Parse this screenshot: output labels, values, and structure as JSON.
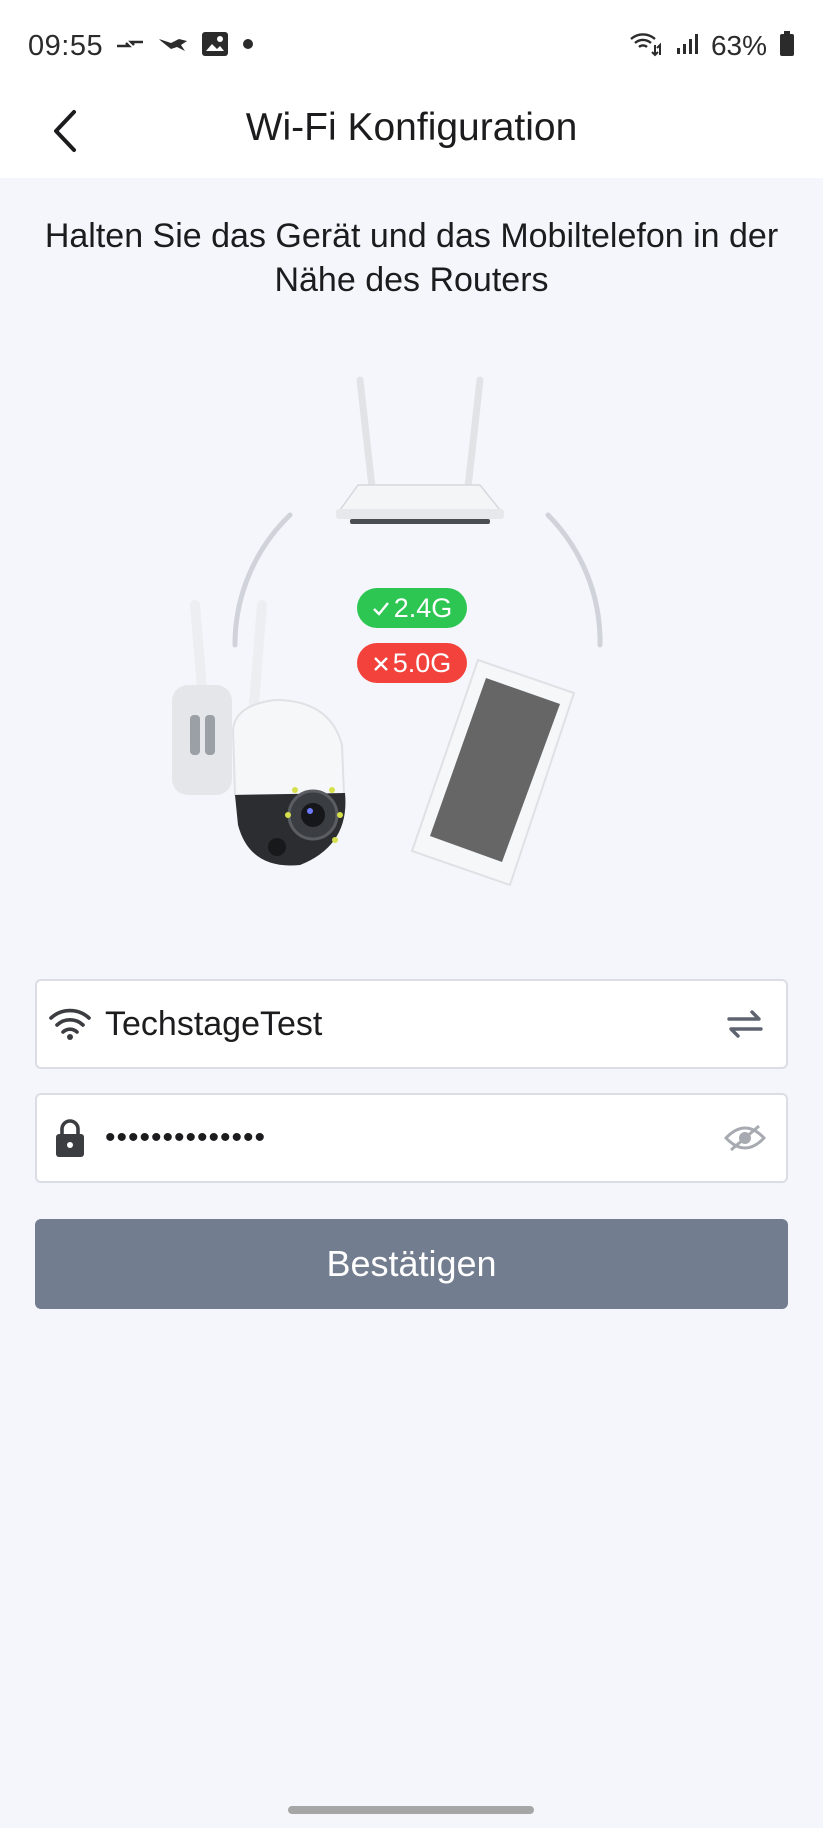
{
  "status_bar": {
    "time": "09:55",
    "battery_percent": "63%",
    "icons": [
      "data-transfer-icon",
      "drone-icon",
      "image-icon",
      "dot-icon",
      "wifi-calling-icon",
      "signal-icon",
      "battery-icon"
    ]
  },
  "header": {
    "title": "Wi-Fi Konfiguration",
    "back_icon": "chevron-left-icon"
  },
  "main": {
    "instruction": "Halten Sie das Gerät und das Mobiltelefon in der Nähe des Routers",
    "band_supported": "2.4G",
    "band_unsupported": "5.0G",
    "ssid_field": {
      "value": "TechstageTest",
      "lead_icon": "wifi-icon",
      "trail_icon": "swap-icon"
    },
    "password_field": {
      "value": "••••••••••••••",
      "lead_icon": "lock-icon",
      "trail_icon": "eye-hidden-icon"
    },
    "confirm_label": "Bestätigen"
  },
  "colors": {
    "background": "#f4f6fb",
    "supported_badge": "#2ec653",
    "unsupported_badge": "#f2423b",
    "button": "#737d90"
  }
}
